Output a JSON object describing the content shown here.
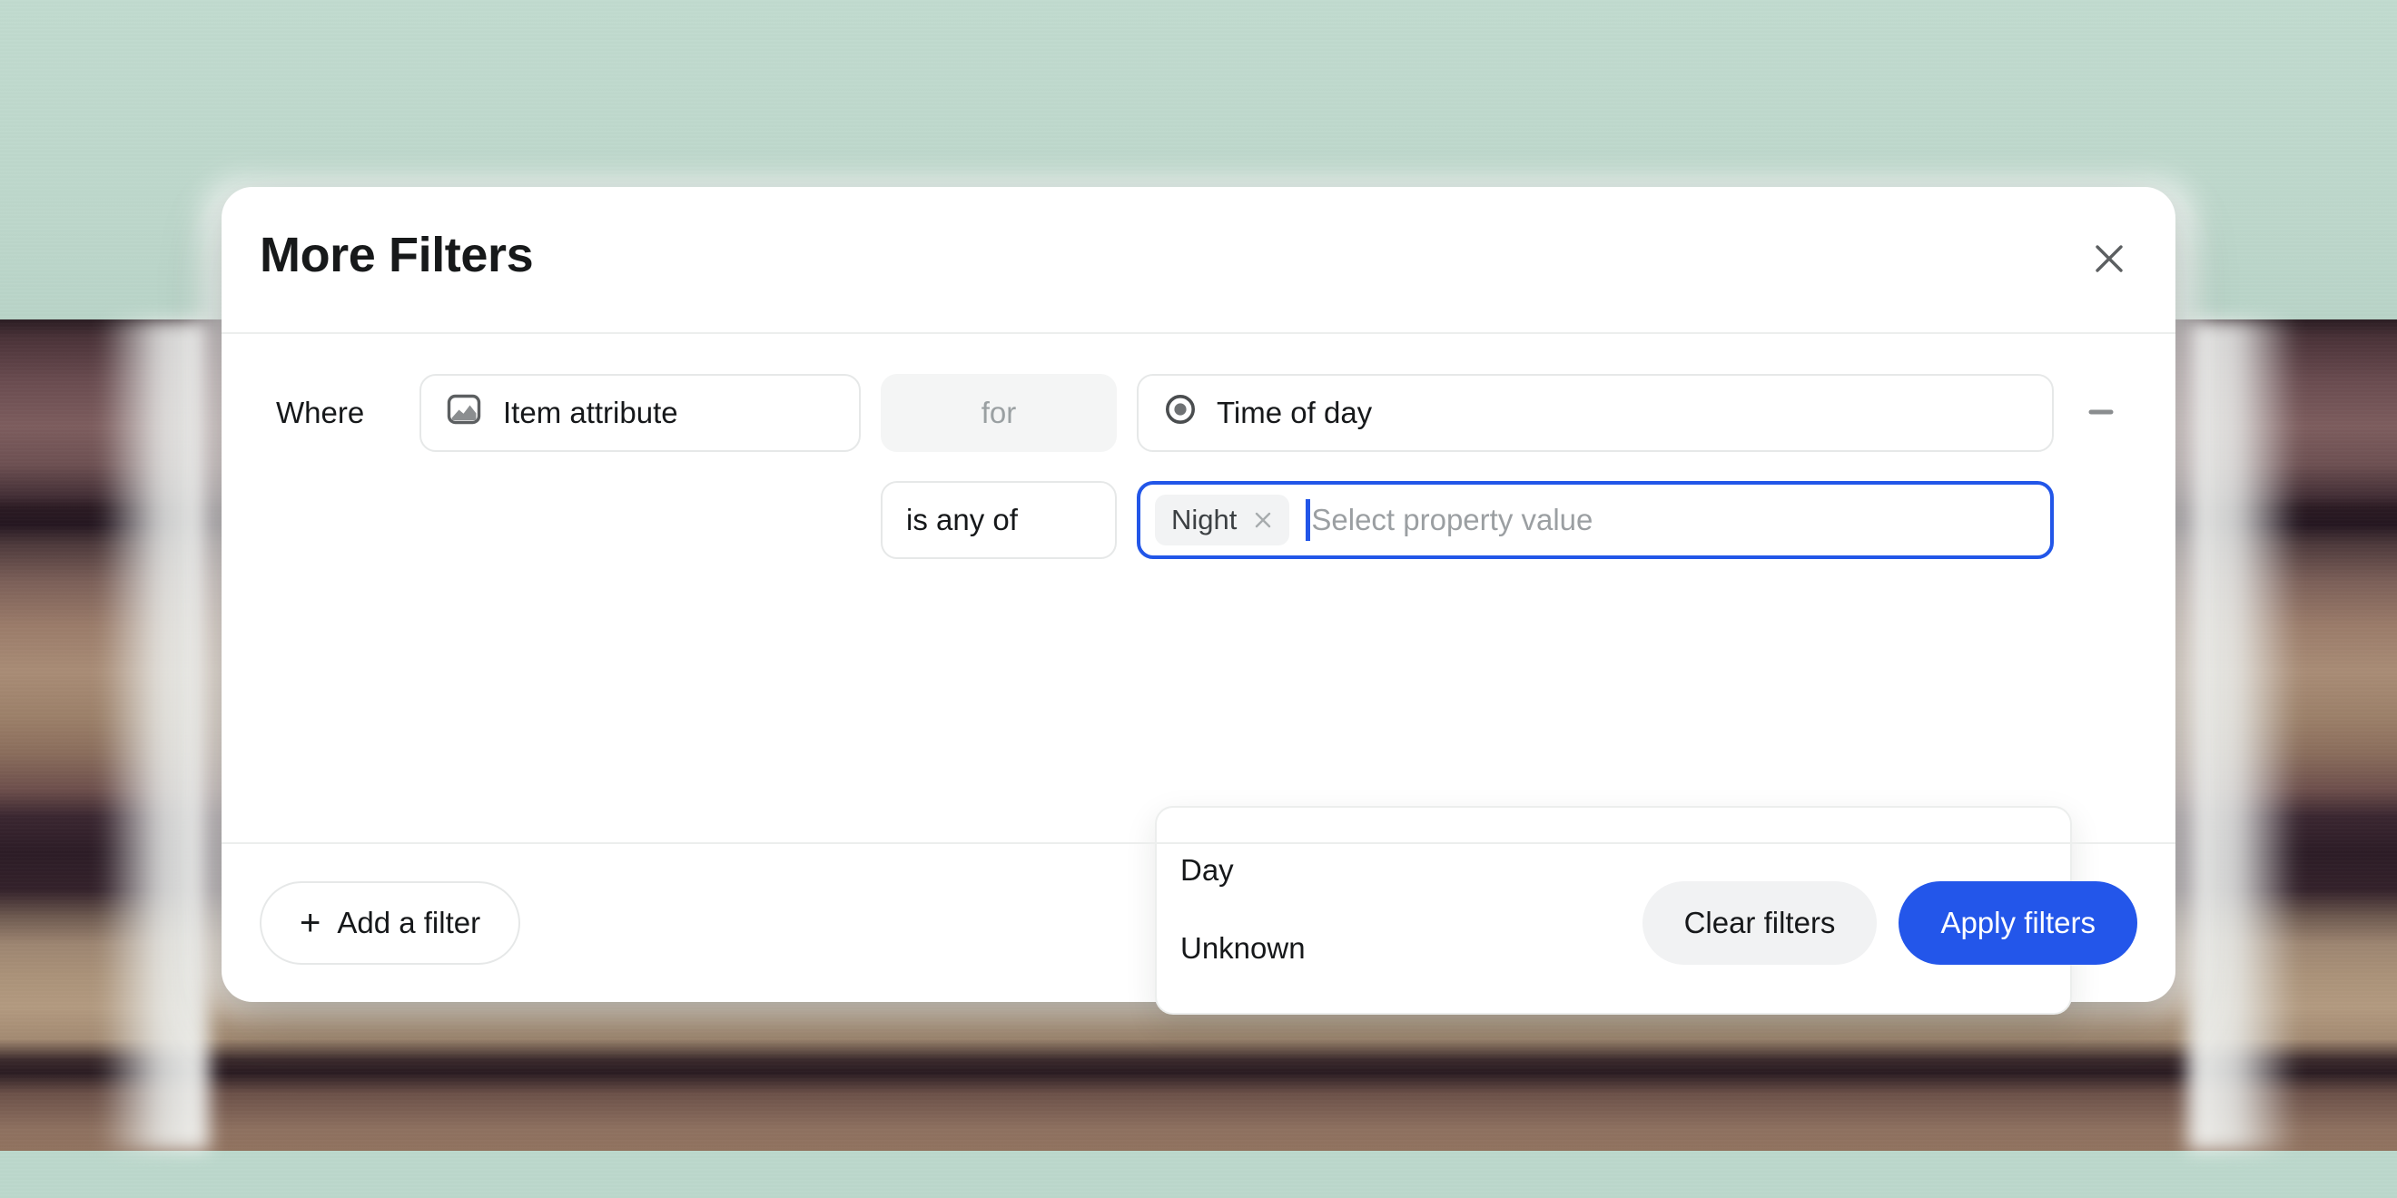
{
  "dialog": {
    "title": "More Filters",
    "close_icon": "close-icon"
  },
  "filter_row": {
    "where_label": "Where",
    "attribute": {
      "icon": "image-icon",
      "label": "Item attribute"
    },
    "conjunction_label": "for",
    "property": {
      "icon": "radio-target-icon",
      "label": "Time of day"
    },
    "remove_icon": "minus-icon"
  },
  "value_row": {
    "operator_label": "is any of",
    "selected_tokens": [
      {
        "label": "Night",
        "remove_icon": "close-small-icon"
      }
    ],
    "placeholder": "Select property value",
    "dropdown_options": [
      {
        "label": "Day"
      },
      {
        "label": "Unknown"
      }
    ]
  },
  "footer": {
    "add_filter_label": "Add a filter",
    "add_filter_plus": "+",
    "clear_filters_label": "Clear filters",
    "apply_filters_label": "Apply filters"
  },
  "colors": {
    "accent_blue": "#2356ea",
    "focus_blue": "#2256e8",
    "backdrop_mint": "#bdd8cc",
    "muted_gray": "#9aa0a2",
    "border_gray": "#e6e8e8"
  }
}
